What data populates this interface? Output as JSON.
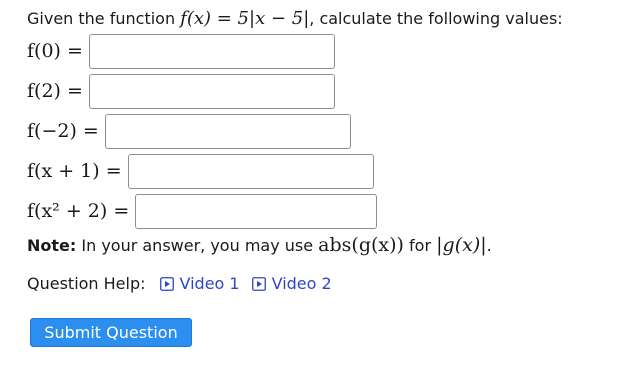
{
  "prompt": {
    "prefix": "Given the function ",
    "function_expr": "f(x) = 5|x − 5|",
    "suffix": ", calculate the following values:"
  },
  "questions": [
    {
      "label": "f(0) =",
      "value": ""
    },
    {
      "label": "f(2) =",
      "value": ""
    },
    {
      "label": "f(−2) =",
      "value": ""
    },
    {
      "label": "f(x + 1) =",
      "value": ""
    },
    {
      "label": "f(x² + 2) =",
      "value": ""
    }
  ],
  "note": {
    "bold": "Note:",
    "text_before": " In your answer, you may use ",
    "abs_expr": "abs(g(x))",
    "text_middle": " for ",
    "abs_bar_expr": "|g(x)|",
    "text_after": "."
  },
  "help": {
    "label": "Question Help:",
    "links": [
      {
        "label": "Video 1",
        "icon": "video-icon"
      },
      {
        "label": "Video 2",
        "icon": "video-icon"
      }
    ]
  },
  "submit": {
    "label": "Submit Question"
  },
  "colors": {
    "link": "#2f44c7",
    "button": "#2c8ff0",
    "input_border": "#8f8f8f"
  }
}
